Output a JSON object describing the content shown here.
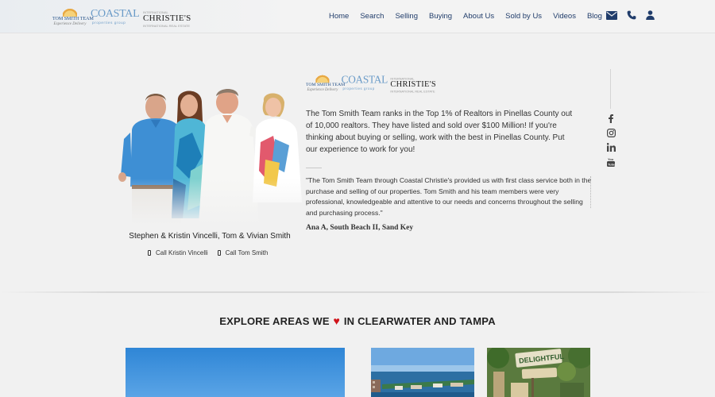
{
  "header": {
    "logos": {
      "team": "TOM SMITH TEAM",
      "team_tagline": "Experience Delivery",
      "coastal": "COASTAL",
      "coastal_sub": "properties group",
      "christies_top": "INTERNATIONAL",
      "christies": "CHRISTIE'S",
      "christies_bottom": "INTERNATIONAL REAL ESTATE"
    },
    "nav": [
      "Home",
      "Search",
      "Selling",
      "Buying",
      "About Us",
      "Sold by Us",
      "Videos",
      "Blog"
    ],
    "icons": [
      "envelope-icon",
      "phone-icon",
      "user-icon"
    ]
  },
  "team": {
    "caption": "Stephen & Kristin Vincelli, Tom & Vivian Smith",
    "call_kristin": "Call Kristin Vincelli",
    "call_tom": "Call Tom Smith"
  },
  "intro": {
    "text": "The Tom Smith Team ranks in the Top 1% of Realtors in Pinellas County out of 10,000 realtors. They have listed and sold over $100 Million! If you're thinking about buying or selling, work with the best in Pinellas County. Put our experience to work for you!",
    "quote": "\"The Tom Smith Team through Coastal Christie's provided us with first class service both in the purchase and selling of our properties. Tom Smith and his team members were very professional, knowledgeable and attentive to our needs and concerns throughout the selling and purchasing process.\"",
    "author": "Ana A, South Beach II, Sand Key"
  },
  "social": [
    "facebook-icon",
    "instagram-icon",
    "linkedin-icon",
    "youtube-icon"
  ],
  "explore": {
    "before": "EXPLORE AREAS WE",
    "heart": "♥",
    "after": "IN CLEARWATER AND TAMPA"
  },
  "colors": {
    "nav_text": "#213d6b",
    "heart": "#d0141b",
    "background": "#f1f1f1"
  }
}
